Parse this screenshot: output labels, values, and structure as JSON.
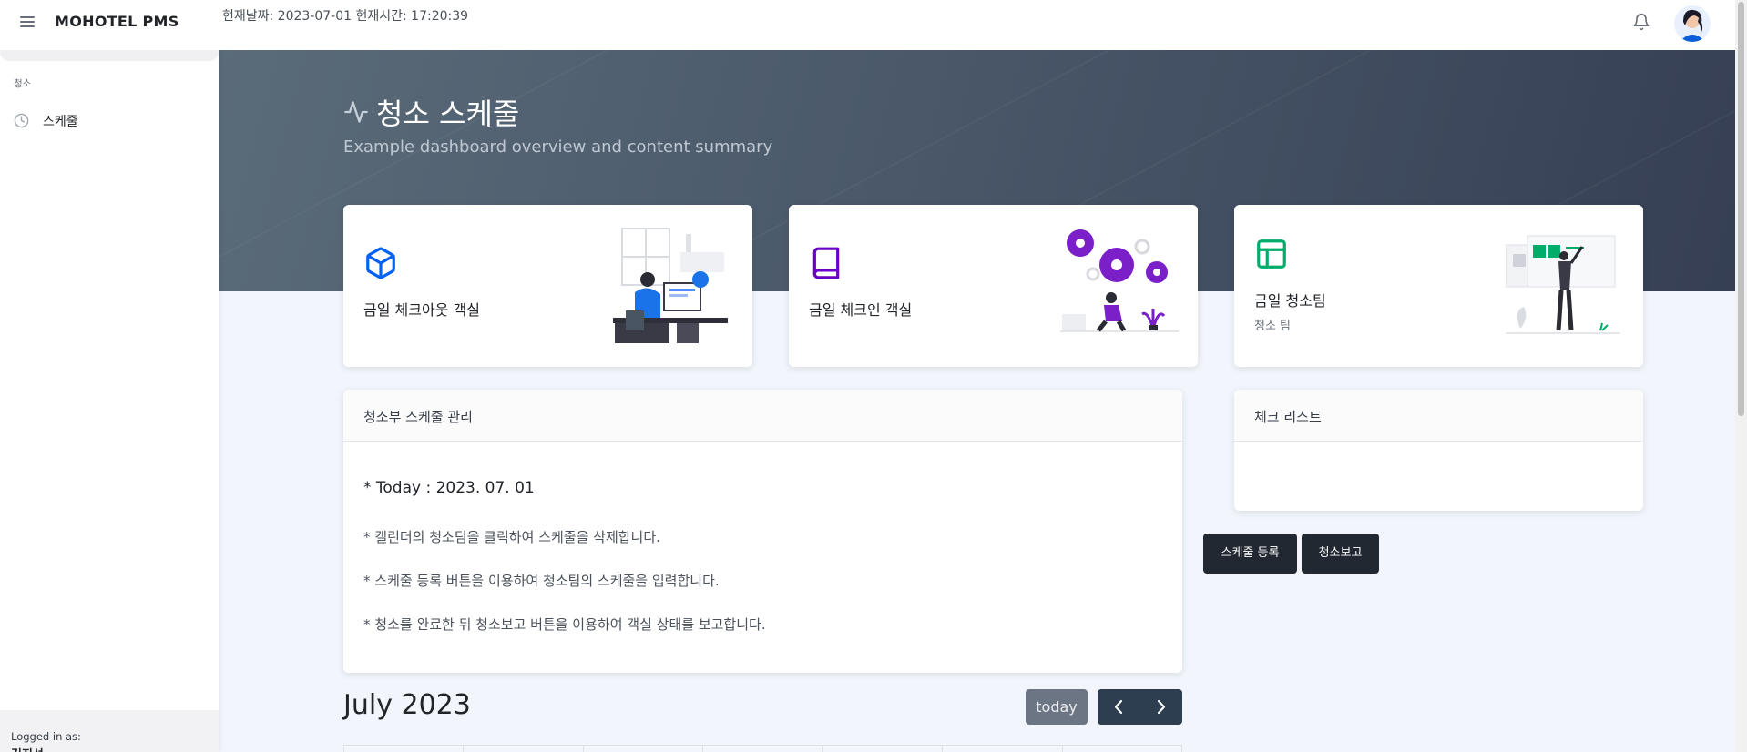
{
  "header": {
    "brand": "MOHOTEL PMS",
    "datetime": "현재날짜: 2023-07-01 현재시간: 17:20:39"
  },
  "sidebar": {
    "section_heading": "청소",
    "items": [
      {
        "label": "스케줄",
        "icon": "clock-icon"
      }
    ],
    "footer_label": "Logged in as:",
    "footer_user": "김진성"
  },
  "page": {
    "title": "청소 스케줄",
    "subtitle": "Example dashboard overview and content summary"
  },
  "stat_cards": [
    {
      "label": "금일 체크아웃 객실",
      "icon": "box-icon",
      "color": "#0061f2"
    },
    {
      "label": "금일 체크인 객실",
      "icon": "book-icon",
      "color": "#6900c7"
    },
    {
      "label": "금일 청소팀",
      "sub": "청소 팀",
      "icon": "layout-icon",
      "color": "#00ac69"
    }
  ],
  "schedule_card": {
    "heading": "청소부 스케줄 관리",
    "today": "* Today : 2023. 07. 01",
    "lines": [
      "* 캘린더의 청소팀을 클릭하여 스케줄을 삭제합니다.",
      "* 스케줄 등록 버튼을 이용하여 청소팀의 스케줄을 입력합니다.",
      "* 청소를 완료한 뒤 청소보고 버튼을 이용하여 객실 상태를 보고합니다."
    ]
  },
  "checklist_card": {
    "heading": "체크 리스트"
  },
  "buttons": {
    "register": "스케줄 등록",
    "report": "청소보고"
  },
  "calendar": {
    "title": "July 2023",
    "today_label": "today"
  }
}
